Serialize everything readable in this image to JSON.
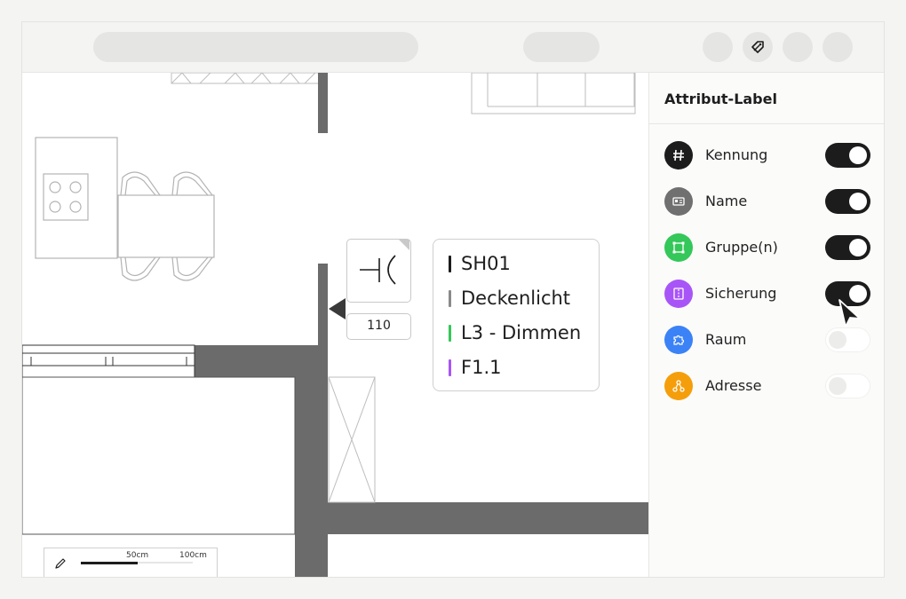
{
  "toolbar": {
    "search_pill": "",
    "mode_pill": "",
    "buttons": [
      {
        "name": "toolbar-button-1",
        "icon": ""
      },
      {
        "name": "tag-button",
        "icon": "tag-icon",
        "active": true
      },
      {
        "name": "toolbar-button-3",
        "icon": ""
      },
      {
        "name": "toolbar-button-4",
        "icon": ""
      }
    ]
  },
  "panel": {
    "title": "Attribut-Label",
    "items": [
      {
        "label": "Kennung",
        "icon": "hash-icon",
        "color": "#1c1c1c",
        "enabled": true
      },
      {
        "label": "Name",
        "icon": "id-card-icon",
        "color": "#707070",
        "enabled": true
      },
      {
        "label": "Gruppe(n)",
        "icon": "group-icon",
        "color": "#34c759",
        "enabled": true
      },
      {
        "label": "Sicherung",
        "icon": "fuse-icon",
        "color": "#a855f7",
        "enabled": true
      },
      {
        "label": "Raum",
        "icon": "puzzle-icon",
        "color": "#3b82f6",
        "enabled": false
      },
      {
        "label": "Adresse",
        "icon": "network-icon",
        "color": "#f59e0b",
        "enabled": false
      }
    ]
  },
  "callout": {
    "lines": [
      {
        "text": "SH01",
        "color": "#1c1c1c"
      },
      {
        "text": "Deckenlicht",
        "color": "#8a8a8a"
      },
      {
        "text": "L3 - Dimmen",
        "color": "#34c759"
      },
      {
        "text": "F1.1",
        "color": "#a855f7"
      }
    ]
  },
  "device": {
    "symbol": "switch-symbol-icon",
    "number": "110"
  },
  "scale": {
    "icon": "pencil-icon",
    "label_50": "50cm",
    "label_100": "100cm"
  }
}
